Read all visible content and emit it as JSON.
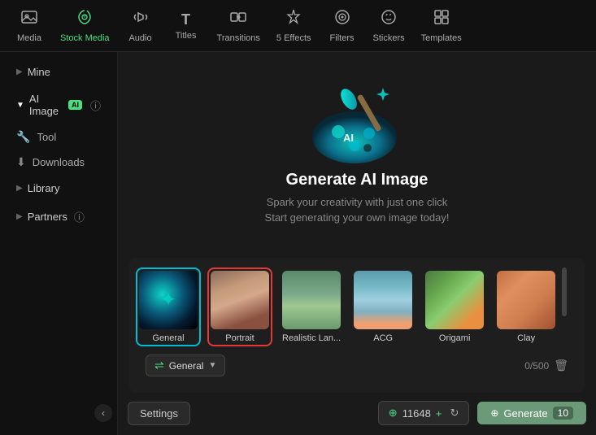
{
  "nav": {
    "items": [
      {
        "id": "media",
        "label": "Media",
        "icon": "🖼",
        "active": false
      },
      {
        "id": "stock-media",
        "label": "Stock Media",
        "icon": "📷",
        "active": true
      },
      {
        "id": "audio",
        "label": "Audio",
        "icon": "🎵",
        "active": false
      },
      {
        "id": "titles",
        "label": "Titles",
        "icon": "T",
        "active": false
      },
      {
        "id": "transitions",
        "label": "Transitions",
        "icon": "⇄",
        "active": false
      },
      {
        "id": "effects",
        "label": "Effects",
        "icon": "✦",
        "active": false,
        "badge": "5 Effects"
      },
      {
        "id": "filters",
        "label": "Filters",
        "icon": "◎",
        "active": false
      },
      {
        "id": "stickers",
        "label": "Stickers",
        "icon": "😊",
        "active": false
      },
      {
        "id": "templates",
        "label": "Templates",
        "icon": "⊞",
        "active": false
      }
    ]
  },
  "sidebar": {
    "items": [
      {
        "id": "mine",
        "label": "Mine",
        "chevron": "▶",
        "expanded": false
      },
      {
        "id": "ai-image",
        "label": "AI Image",
        "chevron": "▼",
        "expanded": true,
        "badge": "AI"
      },
      {
        "id": "tool",
        "label": "Tool",
        "icon": "🔧",
        "sub": true
      },
      {
        "id": "downloads",
        "label": "Downloads",
        "icon": "⬇",
        "sub": true
      },
      {
        "id": "library",
        "label": "Library",
        "chevron": "▶",
        "expanded": false
      },
      {
        "id": "partners",
        "label": "Partners",
        "chevron": "▶",
        "expanded": false,
        "hasInfo": true
      }
    ],
    "collapse_button": "‹"
  },
  "main": {
    "hero_title": "Generate AI Image",
    "hero_subtitle_line1": "Spark your creativity with just one click",
    "hero_subtitle_line2": "Start generating your own image today!",
    "styles": [
      {
        "id": "general",
        "label": "General",
        "active": true
      },
      {
        "id": "portrait",
        "label": "Portrait",
        "selected": true
      },
      {
        "id": "realistic",
        "label": "Realistic Lan...",
        "active": false
      },
      {
        "id": "acg",
        "label": "ACG",
        "active": false
      },
      {
        "id": "origami",
        "label": "Origami",
        "active": false
      },
      {
        "id": "clay",
        "label": "Clay",
        "active": false
      }
    ],
    "style_selector_label": "General",
    "char_count": "0/500",
    "settings_label": "Settings",
    "credits_count": "11648",
    "generate_label": "Generate",
    "generate_count": "10"
  }
}
